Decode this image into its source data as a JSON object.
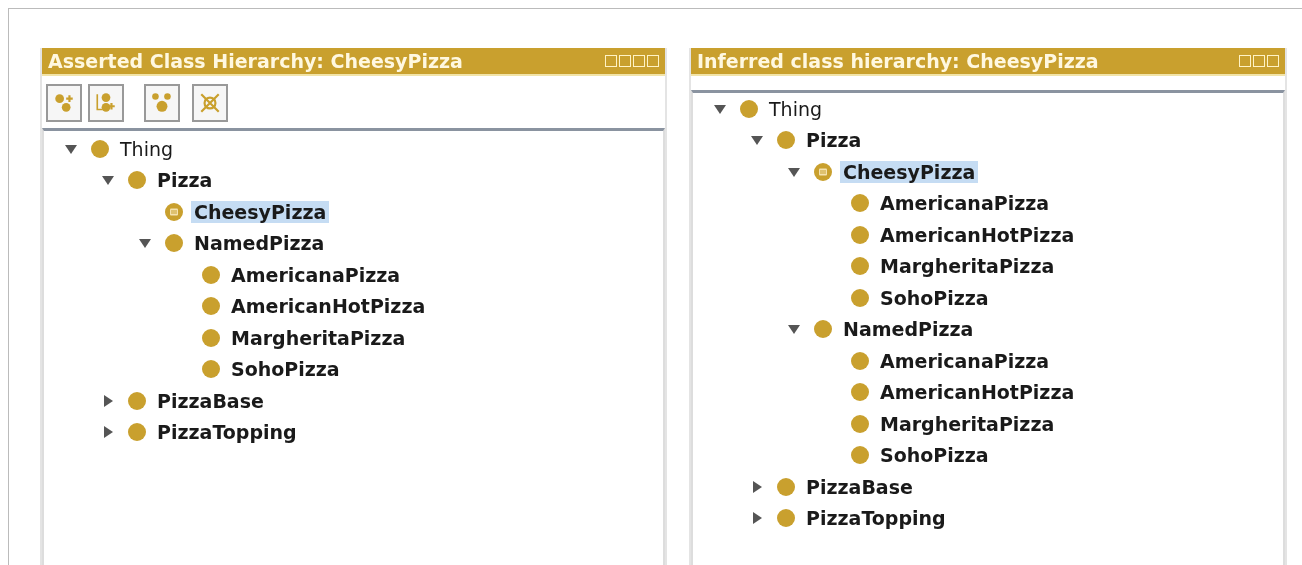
{
  "panels": [
    {
      "kind": "asserted",
      "title": "Asserted Class Hierarchy: CheesyPizza",
      "tree": [
        {
          "label": "Thing",
          "bold": false,
          "kind": "class",
          "expanded": true,
          "selected": false,
          "children": [
            {
              "label": "Pizza",
              "kind": "class",
              "expanded": true,
              "selected": false,
              "children": [
                {
                  "label": "CheesyPizza",
                  "kind": "defined",
                  "selected": true
                },
                {
                  "label": "NamedPizza",
                  "kind": "class",
                  "expanded": true,
                  "selected": false,
                  "children": [
                    {
                      "label": "AmericanaPizza",
                      "kind": "class",
                      "selected": false
                    },
                    {
                      "label": "AmericanHotPizza",
                      "kind": "class",
                      "selected": false
                    },
                    {
                      "label": "MargheritaPizza",
                      "kind": "class",
                      "selected": false
                    },
                    {
                      "label": "SohoPizza",
                      "kind": "class",
                      "selected": false
                    }
                  ]
                }
              ]
            },
            {
              "label": "PizzaBase",
              "kind": "class",
              "expanded": false,
              "selected": false
            },
            {
              "label": "PizzaTopping",
              "kind": "class",
              "expanded": false,
              "selected": false
            }
          ]
        }
      ]
    },
    {
      "kind": "inferred",
      "title": "Inferred class hierarchy: CheesyPizza",
      "tree": [
        {
          "label": "Thing",
          "bold": false,
          "kind": "class",
          "expanded": true,
          "selected": false,
          "children": [
            {
              "label": "Pizza",
              "kind": "class",
              "expanded": true,
              "selected": false,
              "children": [
                {
                  "label": "CheesyPizza",
                  "kind": "defined",
                  "expanded": true,
                  "selected": true,
                  "children": [
                    {
                      "label": "AmericanaPizza",
                      "kind": "class",
                      "selected": false
                    },
                    {
                      "label": "AmericanHotPizza",
                      "kind": "class",
                      "selected": false
                    },
                    {
                      "label": "MargheritaPizza",
                      "kind": "class",
                      "selected": false
                    },
                    {
                      "label": "SohoPizza",
                      "kind": "class",
                      "selected": false
                    }
                  ]
                },
                {
                  "label": "NamedPizza",
                  "kind": "class",
                  "expanded": true,
                  "selected": false,
                  "children": [
                    {
                      "label": "AmericanaPizza",
                      "kind": "class",
                      "selected": false
                    },
                    {
                      "label": "AmericanHotPizza",
                      "kind": "class",
                      "selected": false
                    },
                    {
                      "label": "MargheritaPizza",
                      "kind": "class",
                      "selected": false
                    },
                    {
                      "label": "SohoPizza",
                      "kind": "class",
                      "selected": false
                    }
                  ]
                }
              ]
            },
            {
              "label": "PizzaBase",
              "kind": "class",
              "expanded": false,
              "selected": false
            },
            {
              "label": "PizzaTopping",
              "kind": "class",
              "expanded": false,
              "selected": false
            }
          ]
        }
      ]
    }
  ]
}
